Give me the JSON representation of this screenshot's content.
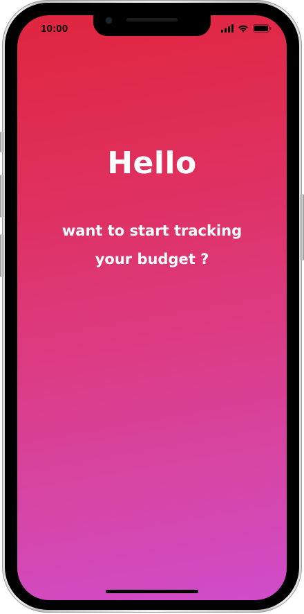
{
  "status_bar": {
    "time": "10:00",
    "signal_icon": "cellular-signal-icon",
    "wifi_icon": "wifi-icon",
    "battery_icon": "battery-icon"
  },
  "main": {
    "greeting": "Hello",
    "prompt_line_1": "want to start tracking",
    "prompt_line_2": "your budget ?"
  },
  "colors": {
    "gradient_top": "#e0263e",
    "gradient_bottom": "#cf4ccb",
    "text": "#ffffff"
  }
}
